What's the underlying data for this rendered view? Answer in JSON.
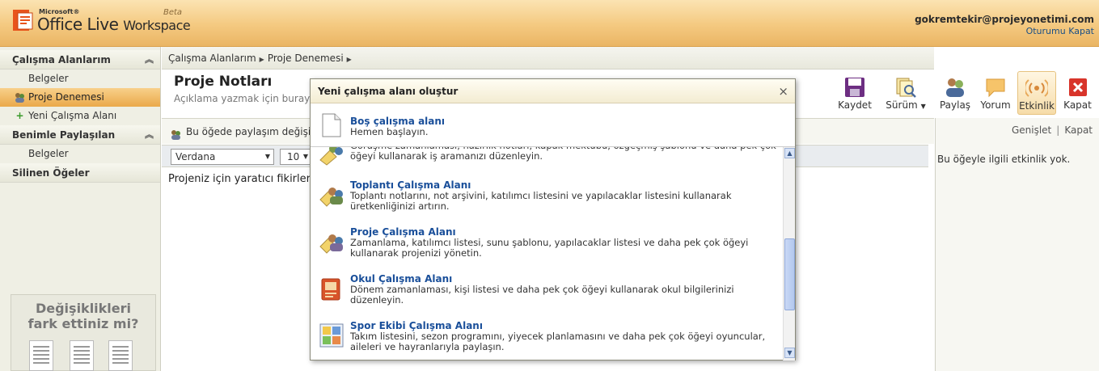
{
  "header": {
    "brand_small": "Microsoft®",
    "brand_office": "Office Live",
    "brand_workspace": "Workspace",
    "brand_beta": "Beta",
    "user_email": "gokremtekir@projeyonetimi.com",
    "signout": "Oturumu Kapat"
  },
  "sidebar": {
    "sections": [
      {
        "label": "Çalışma Alanlarım"
      },
      {
        "label": "Benimle Paylaşılan"
      },
      {
        "label": "Silinen Öğeler"
      }
    ],
    "items": [
      {
        "label": "Belgeler"
      },
      {
        "label": "Proje Denemesi"
      },
      {
        "label": "Yeni Çalışma Alanı"
      },
      {
        "label": "Belgeler"
      }
    ],
    "promo": "Değişiklikleri fark ettiniz mi?"
  },
  "main": {
    "breadcrumb": [
      "Çalışma Alanlarım",
      "Proje Denemesi"
    ],
    "title": "Proje Notları",
    "description": "Açıklama yazmak için burayı",
    "share_text": "Bu öğede paylaşım değişik",
    "font": "Verdana",
    "size": "10",
    "doc_text": "Projeniz için yaratıcı fikirler"
  },
  "toolbar": {
    "save": "Kaydet",
    "version": "Sürüm",
    "share": "Paylaş",
    "comment": "Yorum",
    "activity": "Etkinlik",
    "close": "Kapat"
  },
  "right_panel": {
    "expand": "Genişlet",
    "close": "Kapat",
    "empty": "Bu öğeyle ilgili etkinlik yok."
  },
  "dialog": {
    "title": "Yeni çalışma alanı oluştur",
    "close": "×",
    "blank": {
      "title": "Boş çalışma alanı",
      "desc": "Hemen başlayın."
    },
    "partial_desc": "Görüşme zamanlaması, hazırlık notları, kapak mektubu, özgeçmiş şablonu ve daha pek çok öğeyi kullanarak iş aramanızı düzenleyin.",
    "options": [
      {
        "title": "Toplantı Çalışma Alanı",
        "desc": "Toplantı notlarını, not arşivini, katılımcı listesini ve yapılacaklar listesini kullanarak üretkenliğinizi artırın."
      },
      {
        "title": "Proje Çalışma Alanı",
        "desc": "Zamanlama, katılımcı listesi, sunu şablonu, yapılacaklar listesi ve daha pek çok öğeyi kullanarak projenizi yönetin."
      },
      {
        "title": "Okul Çalışma Alanı",
        "desc": "Dönem zamanlaması, kişi listesi ve daha pek çok öğeyi kullanarak okul bilgilerinizi düzenleyin."
      },
      {
        "title": "Spor Ekibi Çalışma Alanı",
        "desc": "Takım listesini, sezon programını, yiyecek planlamasını ve daha pek çok öğeyi oyuncular, aileleri ve hayranlarıyla paylaşın."
      }
    ]
  },
  "colors": {
    "header_orange": "#f4c980",
    "link_blue": "#1a4f9a",
    "selected_orange": "#eaa94a"
  }
}
